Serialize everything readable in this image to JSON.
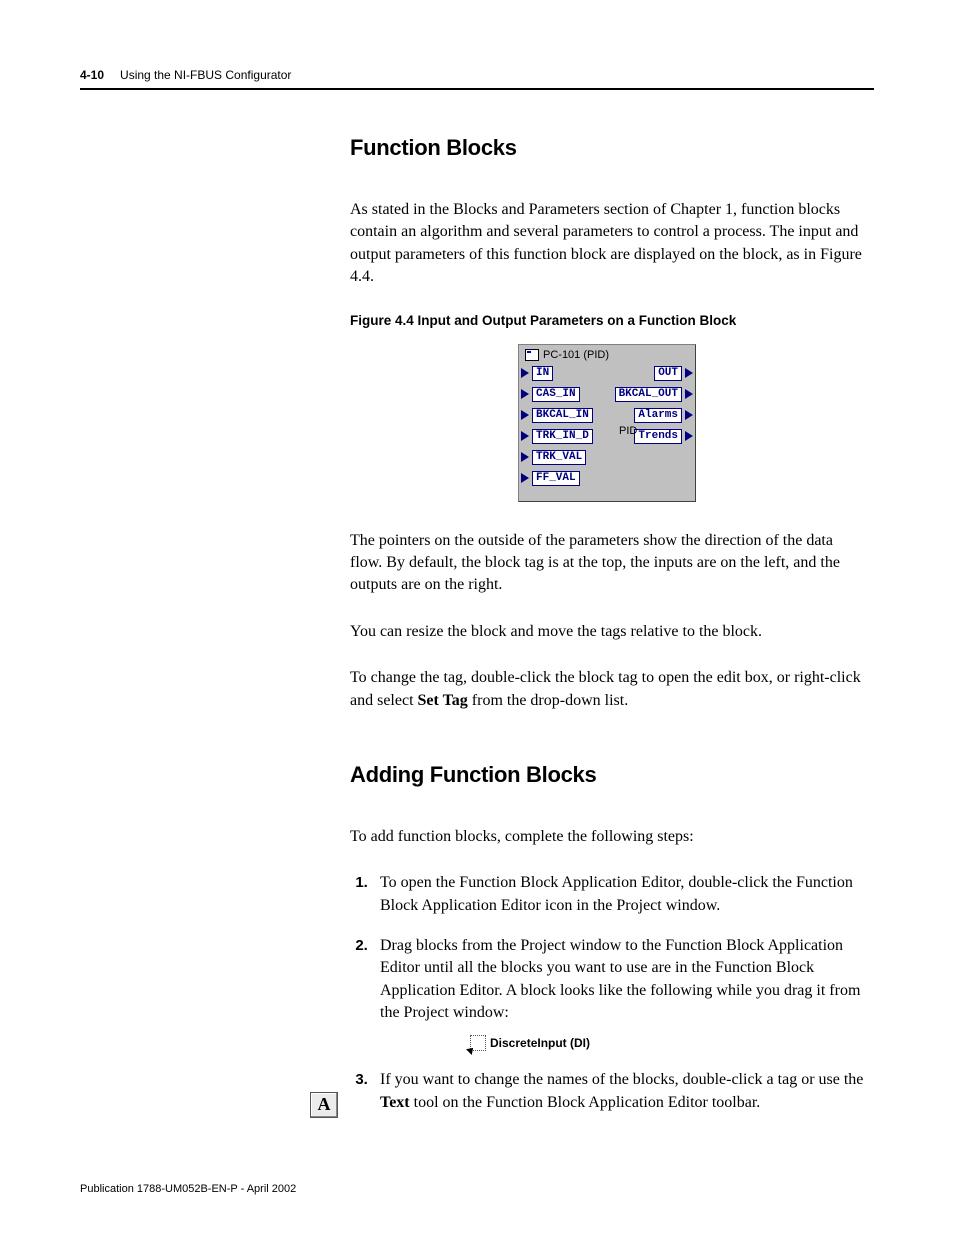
{
  "header": {
    "page_number": "4-10",
    "doc_section": "Using the NI-FBUS Configurator"
  },
  "section1": {
    "title": "Function Blocks",
    "para1": "As stated in the Blocks and Parameters section of Chapter 1, function blocks contain an algorithm and several parameters to control a process. The input and output parameters of this function block are displayed on the block, as in Figure 4.4.",
    "fig_caption": "Figure 4.4 Input and Output Parameters on a Function Block",
    "block": {
      "title": "PC-101 (PID)",
      "center_label": "PID",
      "inputs": [
        "IN",
        "CAS_IN",
        "BKCAL_IN",
        "TRK_IN_D",
        "TRK_VAL",
        "FF_VAL"
      ],
      "outputs": [
        "OUT",
        "BKCAL_OUT",
        "Alarms",
        "Trends"
      ]
    },
    "para2": "The pointers on the outside of the parameters show the direction of the data flow. By default, the block tag is at the top, the inputs are on the left, and the outputs are on the right.",
    "para3": "You can resize the block and move the tags relative to the block.",
    "para4_a": "To change the tag, double-click the block tag to open the edit box, or right-click and select ",
    "para4_bold": "Set Tag",
    "para4_b": " from the drop-down list."
  },
  "section2": {
    "title": "Adding Function Blocks",
    "intro": "To add function blocks, complete the following steps:",
    "step1": "To open the Function Block Application Editor, double-click the Function Block Application Editor icon in the Project window.",
    "step2": "Drag blocks from the Project window to the Function Block Application Editor until all the blocks you want to use are in the Function Block Application Editor. A block looks like the following while you drag it from the Project window:",
    "drag_label": "DiscreteInput (DI)",
    "step3_a": "If you want to change the names of the blocks, double-click a tag or use the ",
    "step3_bold": "Text",
    "step3_b": " tool on the Function Block Application Editor toolbar."
  },
  "text_tool_glyph": "A",
  "footer": "Publication 1788-UM052B-EN-P - April 2002"
}
